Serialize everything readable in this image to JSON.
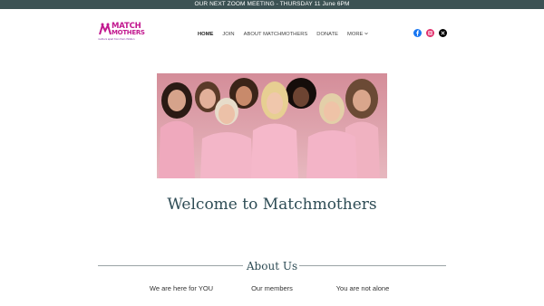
{
  "announcement": "OUR NEXT ZOOM MEETING - THURSDAY 11 June 6PM",
  "logo": {
    "line1": "MATCH",
    "line2": "MOTHERS",
    "tagline": "mothers apart from their children",
    "brand_color": "#c2188f"
  },
  "nav": {
    "items": [
      {
        "label": "HOME",
        "active": true
      },
      {
        "label": "JOIN"
      },
      {
        "label": "ABOUT MATCHMOTHERS"
      },
      {
        "label": "DONATE"
      },
      {
        "label": "MORE"
      }
    ]
  },
  "social": [
    {
      "icon": "facebook-icon",
      "color": "#1877f2"
    },
    {
      "icon": "instagram-icon",
      "color": "#e1306c"
    },
    {
      "icon": "x-icon",
      "color": "#000000"
    }
  ],
  "hero": {
    "alt": "Group of women wearing pink t-shirts"
  },
  "welcome": "Welcome to Matchmothers",
  "about": {
    "title": "About Us",
    "features": [
      "We are here for YOU",
      "Our members",
      "You are not alone"
    ]
  },
  "colors": {
    "topbar_bg": "#3c5254",
    "heading": "#2e4c55"
  }
}
